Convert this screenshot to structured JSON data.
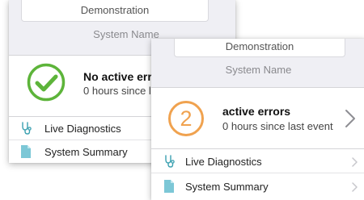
{
  "back_screen": {
    "system_field_value": "Demonstration",
    "system_field_label": "System Name",
    "status": {
      "state": "ok",
      "icon": "checkmark-circle-icon",
      "title": "No active errors",
      "subtitle": "0 hours since last event"
    },
    "menu": [
      {
        "icon": "stethoscope-icon",
        "label": "Live Diagnostics"
      },
      {
        "icon": "document-icon",
        "label": "System Summary"
      }
    ]
  },
  "front_screen": {
    "system_field_value": "Demonstration",
    "system_field_label": "System Name",
    "status": {
      "state": "warning",
      "error_count": "2",
      "title": "active errors",
      "subtitle": "0 hours since last event"
    },
    "menu": [
      {
        "icon": "stethoscope-icon",
        "label": "Live Diagnostics"
      },
      {
        "icon": "document-icon",
        "label": "System Summary"
      }
    ]
  },
  "colors": {
    "ok_green": "#5db43a",
    "warning_orange": "#f0a24f",
    "icon_teal": "#3aa0b0",
    "chevron_gray": "#c7c7cc"
  }
}
